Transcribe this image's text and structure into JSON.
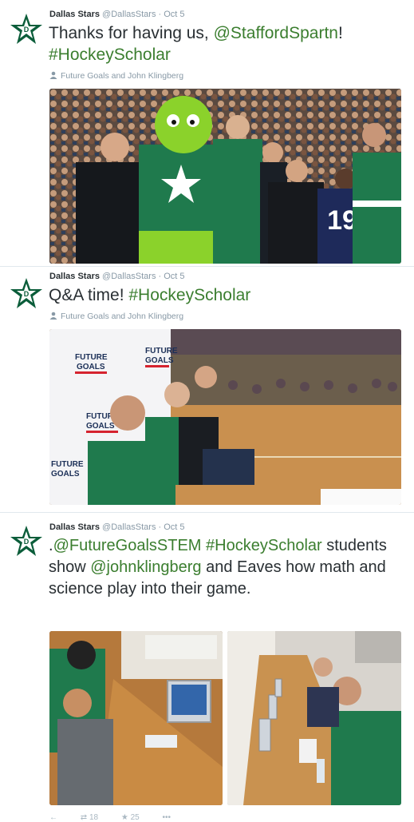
{
  "tweets": [
    {
      "author": "Dallas Stars",
      "handle": "@DallasStars",
      "date": "Oct 5",
      "segments": [
        {
          "text": "Thanks for having us, ",
          "link": false
        },
        {
          "text": "@StaffordSpartn",
          "link": true
        },
        {
          "text": "!",
          "link": false
        },
        {
          "text": " ",
          "link": false
        },
        {
          "text": "#HockeyScholar",
          "link": true
        }
      ],
      "tagged": "Future Goals and John Klingberg"
    },
    {
      "author": "Dallas Stars",
      "handle": "@DallasStars",
      "date": "Oct 5",
      "segments": [
        {
          "text": "Q&A time! ",
          "link": false
        },
        {
          "text": "#HockeyScholar",
          "link": true
        }
      ],
      "tagged": "Future Goals and John Klingberg",
      "banner_words": [
        "FUTURE",
        "GOALS"
      ]
    },
    {
      "author": "Dallas Stars",
      "handle": "@DallasStars",
      "date": "Oct 5",
      "segments": [
        {
          "text": ".",
          "link": false
        },
        {
          "text": "@FutureGoalsSTEM",
          "link": true
        },
        {
          "text": " ",
          "link": false
        },
        {
          "text": "#HockeyScholar",
          "link": true
        },
        {
          "text": " students show ",
          "link": false
        },
        {
          "text": "@johnklingberg",
          "link": true
        },
        {
          "text": " and Eaves how math and science play into their game.",
          "link": false
        }
      ]
    }
  ],
  "jersey_number": "19",
  "actions": {
    "reply": "←",
    "retweet": "⇄ 18",
    "favorite": "★ 25",
    "more": "•••"
  },
  "icons": {
    "avatar": "dallas-stars-logo-icon",
    "tag": "person-icon"
  },
  "colors": {
    "link": "#3b7e2f",
    "stars_green": "#1f7a4d",
    "muted": "#8899a6"
  }
}
